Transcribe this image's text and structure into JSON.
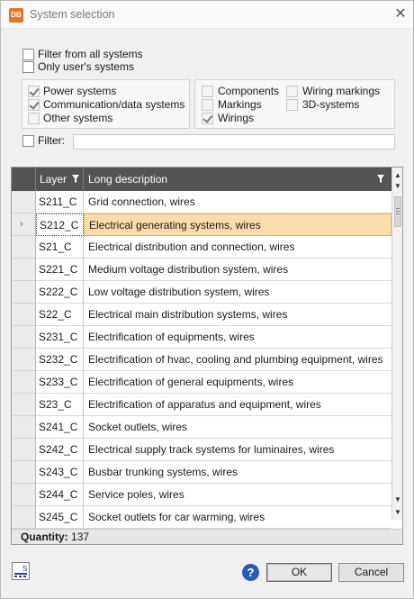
{
  "window": {
    "title": "System selection",
    "app_icon_text": "DB"
  },
  "options": {
    "filter_all": {
      "label": "Filter from all systems",
      "checked": false
    },
    "only_user": {
      "label": "Only user's systems",
      "checked": false
    }
  },
  "group1": [
    {
      "label": "Power systems",
      "checked": true
    },
    {
      "label": "Communication/data systems",
      "checked": true
    },
    {
      "label": "Other systems",
      "checked": false
    }
  ],
  "group2": [
    {
      "label": "Components",
      "checked": false
    },
    {
      "label": "Markings",
      "checked": false
    },
    {
      "label": "Wirings",
      "checked": true
    },
    {
      "label": "Wiring markings",
      "checked": false
    },
    {
      "label": "3D-systems",
      "checked": false
    }
  ],
  "filter": {
    "label": "Filter:",
    "value": ""
  },
  "table": {
    "columns": [
      "Layer",
      "Long description"
    ],
    "rows": [
      [
        "S211_C",
        "Grid connection, wires"
      ],
      [
        "S212_C",
        "Electrical generating systems, wires"
      ],
      [
        "S21_C",
        "Electrical distribution and connection, wires"
      ],
      [
        "S221_C",
        "Medium voltage distribution system, wires"
      ],
      [
        "S222_C",
        "Low voltage distribution system, wires"
      ],
      [
        "S22_C",
        "Electrical main distribution systems, wires"
      ],
      [
        "S231_C",
        "Electrification of equipments, wires"
      ],
      [
        "S232_C",
        "Electrification of hvac, cooling and plumbing equipment, wires"
      ],
      [
        "S233_C",
        "Electrification of general equipments, wires"
      ],
      [
        "S23_C",
        "Electrification of apparatus and equipment, wires"
      ],
      [
        "S241_C",
        "Socket outlets, wires"
      ],
      [
        "S242_C",
        "Electrical supply track systems for luminaires, wires"
      ],
      [
        "S243_C",
        "Busbar trunking systems, wires"
      ],
      [
        "S244_C",
        "Service poles, wires"
      ],
      [
        "S245_C",
        "Socket outlets for car warming, wires"
      ]
    ],
    "selected_row": 1,
    "quantity_label": "Quantity:",
    "quantity_value": "137"
  },
  "buttons": {
    "ok": "OK",
    "cancel": "Cancel",
    "help": "?",
    "tool_icon_text": "S"
  },
  "colors": {
    "accent": "#e8742a",
    "selected_row": "#fbdcaa",
    "header": "#545454"
  }
}
